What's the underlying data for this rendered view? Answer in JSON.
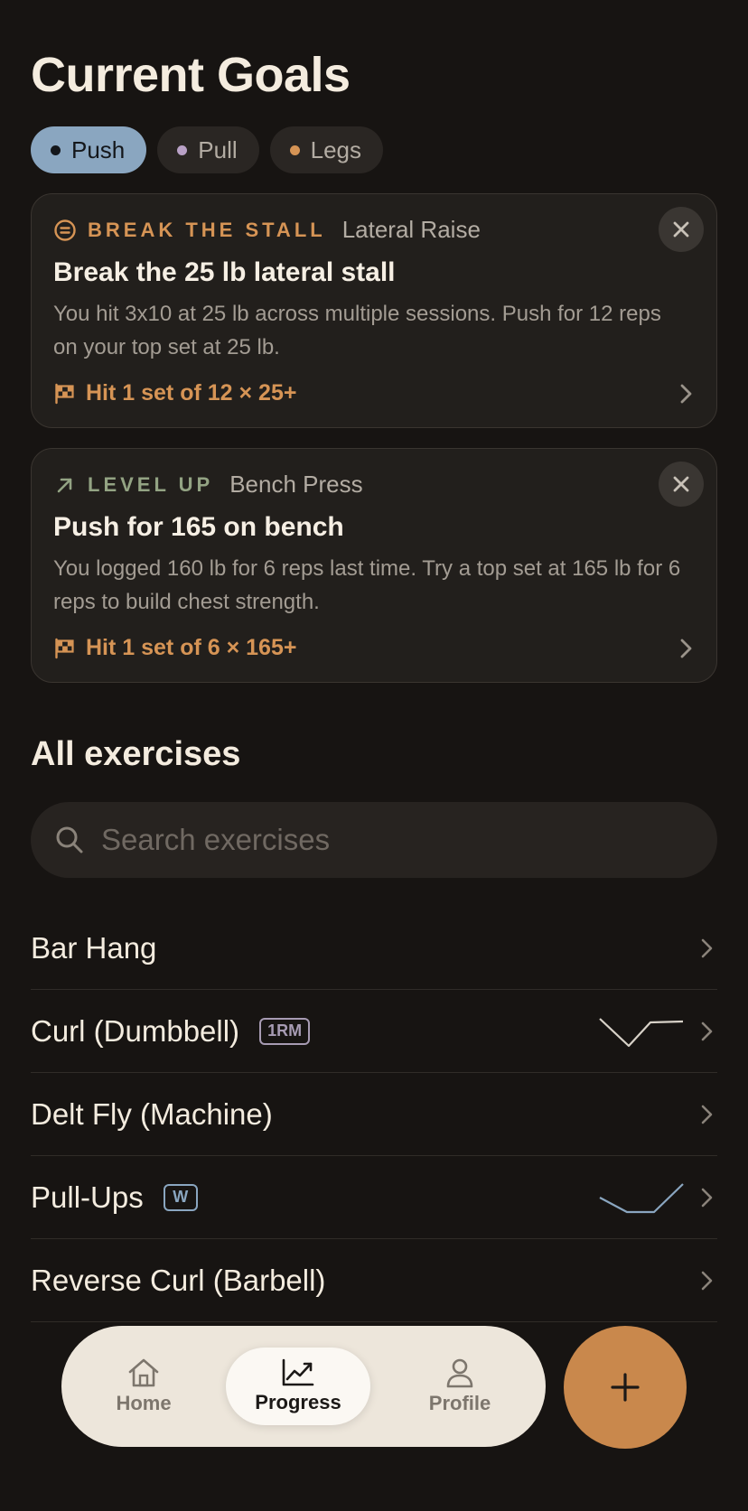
{
  "header": {
    "title": "Current Goals"
  },
  "filters": [
    {
      "label": "Push",
      "active": true,
      "dot_color": "#14171b"
    },
    {
      "label": "Pull",
      "active": false,
      "dot_color": "#b9a1c6"
    },
    {
      "label": "Legs",
      "active": false,
      "dot_color": "#d69455"
    }
  ],
  "goals": [
    {
      "badge": "BREAK THE STALL",
      "badge_color": "#d69455",
      "badge_icon": "equals-circle-icon",
      "exercise": "Lateral Raise",
      "headline": "Break the 25 lb lateral stall",
      "description": "You hit 3x10 at 25 lb across multiple sessions. Push for 12 reps on your top set at 25 lb.",
      "target": "Hit 1 set of 12 × 25+",
      "target_icon": "checkered-flag-icon"
    },
    {
      "badge": "LEVEL UP",
      "badge_color": "#93a383",
      "badge_icon": "arrow-up-right-icon",
      "exercise": "Bench Press",
      "headline": "Push for 165 on bench",
      "description": "You logged 160 lb for 6 reps last time. Try a top set at 165 lb for 6 reps to build chest strength.",
      "target": "Hit 1 set of 6 × 165+",
      "target_icon": "checkered-flag-icon"
    }
  ],
  "exercises_section": {
    "title": "All exercises",
    "search_placeholder": "Search exercises",
    "items": [
      {
        "name": "Bar Hang",
        "tag": null,
        "trend": null
      },
      {
        "name": "Curl (Dumbbell)",
        "tag": "1RM",
        "tag_color": "#a79bb3",
        "trend": "down-then-up",
        "trend_color": "#d8d2c8"
      },
      {
        "name": "Delt Fly (Machine)",
        "tag": null,
        "trend": null
      },
      {
        "name": "Pull-Ups",
        "tag": "W",
        "tag_color": "#8aa6c0",
        "trend": "down-flat-up",
        "trend_color": "#8aa6c0"
      },
      {
        "name": "Reverse Curl (Barbell)",
        "tag": null,
        "trend": null
      }
    ]
  },
  "tabbar": {
    "tabs": [
      {
        "label": "Home",
        "icon": "home-icon",
        "active": false
      },
      {
        "label": "Progress",
        "icon": "chart-trend-icon",
        "active": true
      },
      {
        "label": "Profile",
        "icon": "person-icon",
        "active": false
      }
    ],
    "fab_icon": "plus-icon"
  }
}
